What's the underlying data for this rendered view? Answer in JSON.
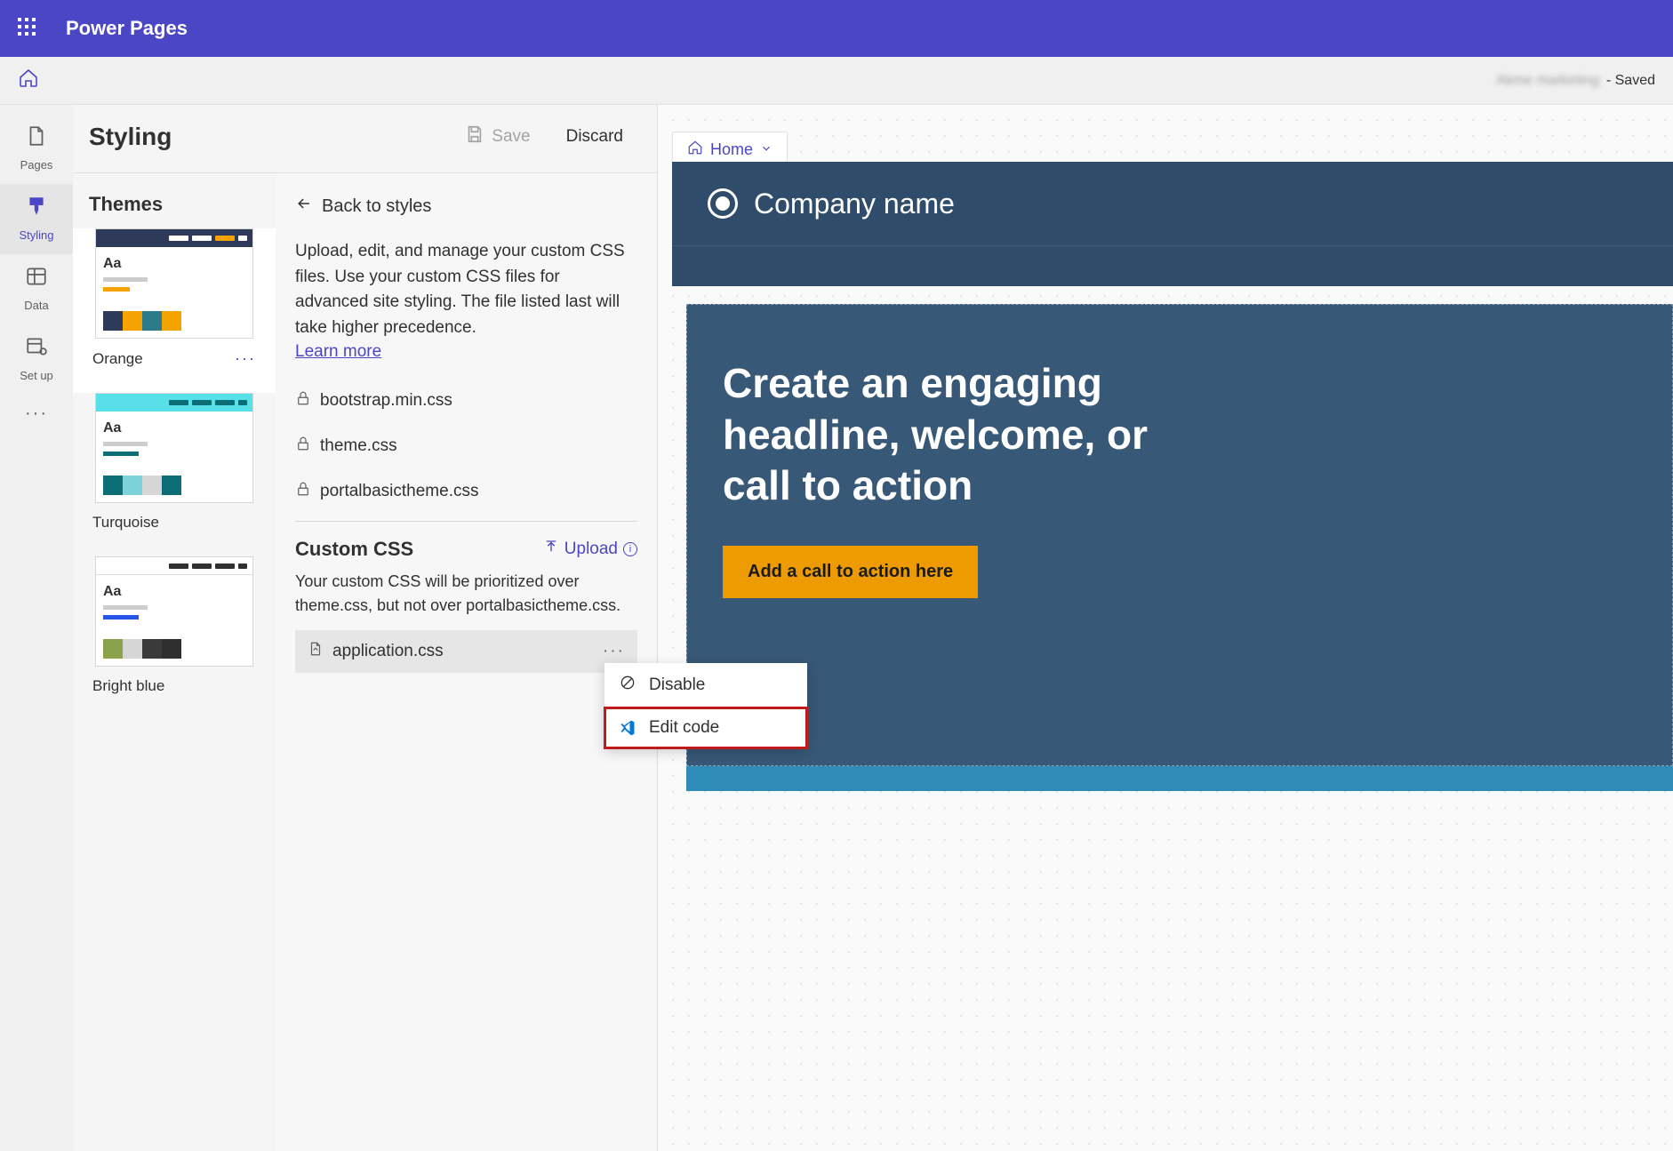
{
  "topbar": {
    "brand": "Power Pages"
  },
  "subbar": {
    "site_name": "Akme marketing",
    "saved": " - Saved"
  },
  "leftnav": {
    "items": [
      {
        "icon": "page",
        "label": "Pages"
      },
      {
        "icon": "brush",
        "label": "Styling",
        "active": true
      },
      {
        "icon": "grid",
        "label": "Data"
      },
      {
        "icon": "gear-grid",
        "label": "Set up"
      }
    ]
  },
  "styling": {
    "title": "Styling",
    "save": "Save",
    "discard": "Discard"
  },
  "themes": {
    "title": "Themes",
    "list": [
      {
        "label": "Orange",
        "bar_color": "#2f3a5a",
        "accent": "#f5a300",
        "swatches": [
          "#2f3a5a",
          "#f5a300",
          "#2c7b8a",
          "#f5a300"
        ],
        "active": true
      },
      {
        "label": "Turquoise",
        "bar_color": "#57e0e8",
        "accent": "#0b6e77",
        "swatches": [
          "#0b6e77",
          "#7bd3d9",
          "#d6d6d6",
          "#0b6e77"
        ]
      },
      {
        "label": "Bright blue",
        "bar_color": "#2f2f2f",
        "accent": "#2455e6",
        "swatches": [
          "#8aa34a",
          "#d6d6d6",
          "#3a3a3a",
          "#2f2f2f"
        ]
      }
    ]
  },
  "styles": {
    "back": "Back to styles",
    "desc": "Upload, edit, and manage your custom CSS files. Use your custom CSS files for advanced site styling. The file listed last will take higher precedence.",
    "learn_more": "Learn more",
    "locked_files": [
      "bootstrap.min.css",
      "theme.css",
      "portalbasictheme.css"
    ],
    "custom_title": "Custom CSS",
    "upload": "Upload",
    "custom_desc": "Your custom CSS will be prioritized over theme.css, but not over portalbasictheme.css.",
    "custom_file": "application.css"
  },
  "context_menu": {
    "disable": "Disable",
    "edit_code": "Edit code"
  },
  "breadcrumb": {
    "home": "Home"
  },
  "preview": {
    "company": "Company name",
    "headline": "Create an engaging headline, welcome, or call to action",
    "cta": "Add a call to action here"
  }
}
